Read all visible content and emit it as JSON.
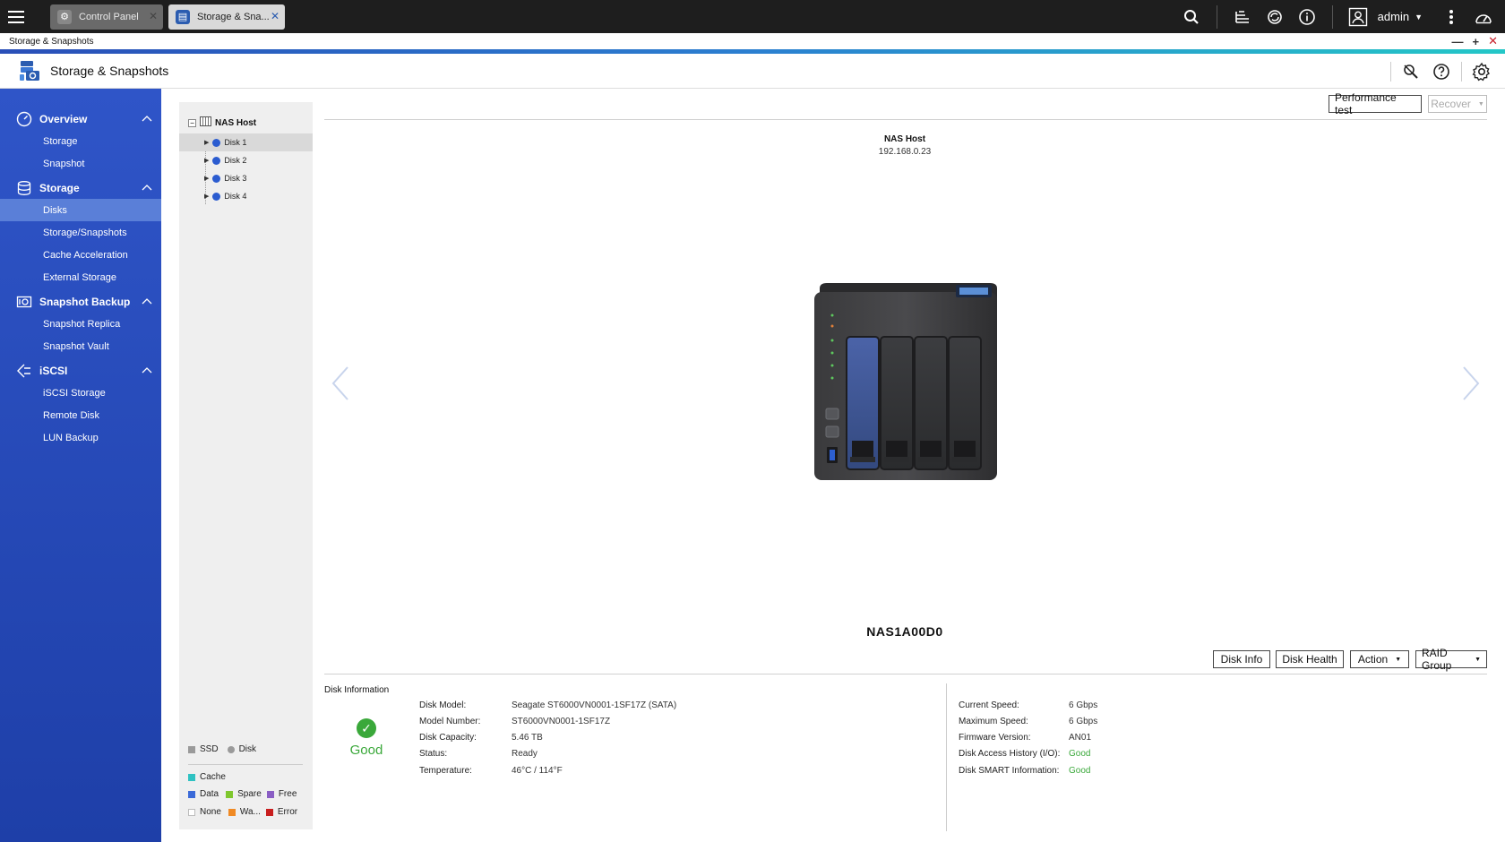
{
  "topbar": {
    "tabs": [
      {
        "label": "Control Panel"
      },
      {
        "label": "Storage & Sna..."
      }
    ],
    "user": "admin"
  },
  "window": {
    "title": "Storage & Snapshots",
    "controls": {
      "minimize": "—",
      "maximize": "+",
      "close": "✕"
    }
  },
  "app": {
    "title": "Storage & Snapshots"
  },
  "sidebar": {
    "groups": [
      {
        "label": "Overview",
        "items": [
          "Storage",
          "Snapshot"
        ]
      },
      {
        "label": "Storage",
        "items": [
          "Disks",
          "Storage/Snapshots",
          "Cache Acceleration",
          "External Storage"
        ]
      },
      {
        "label": "Snapshot Backup",
        "items": [
          "Snapshot Replica",
          "Snapshot Vault"
        ]
      },
      {
        "label": "iSCSI",
        "items": [
          "iSCSI Storage",
          "Remote Disk",
          "LUN Backup"
        ]
      }
    ],
    "active_item": "Disks"
  },
  "tree": {
    "root": "NAS Host",
    "disks": [
      "Disk 1",
      "Disk 2",
      "Disk 3",
      "Disk 4"
    ]
  },
  "legend": {
    "ssd": "SSD",
    "disk": "Disk",
    "cache": "Cache",
    "data": "Data",
    "spare": "Spare",
    "free": "Free",
    "none": "None",
    "warning": "Wa...",
    "error": "Error",
    "colors": {
      "ssd": "#9a9a9a",
      "disk": "#9a9a9a",
      "cache": "#2fc2c2",
      "data": "#3b6ad8",
      "spare": "#7fc72e",
      "free": "#8a5ec4",
      "none": "#ffffff",
      "warning": "#f08a24",
      "error": "#c81e1e"
    }
  },
  "toolbar": {
    "performance_test": "Performance test",
    "recover": "Recover"
  },
  "host": {
    "name": "NAS Host",
    "ip": "192.168.0.23",
    "model": "NAS1A00D0"
  },
  "disk_actions": {
    "disk_info": "Disk Info",
    "disk_health": "Disk Health",
    "action": "Action",
    "raid_group": "RAID Group"
  },
  "disk_information": {
    "title": "Disk Information",
    "status_text": "Good",
    "left": [
      {
        "label": "Disk Model:",
        "value": "Seagate ST6000VN0001-1SF17Z (SATA)"
      },
      {
        "label": "Model Number:",
        "value": "ST6000VN0001-1SF17Z"
      },
      {
        "label": "Disk Capacity:",
        "value": "5.46 TB"
      },
      {
        "label": "Status:",
        "value": "Ready"
      },
      {
        "label": "Temperature:",
        "value": "46°C / 114°F"
      }
    ],
    "right": [
      {
        "label": "Current Speed:",
        "value": "6 Gbps"
      },
      {
        "label": "Maximum Speed:",
        "value": "6 Gbps"
      },
      {
        "label": "Firmware Version:",
        "value": "AN01"
      },
      {
        "label": "Disk Access History (I/O):",
        "value": "Good"
      },
      {
        "label": "Disk SMART Information:",
        "value": "Good"
      }
    ]
  }
}
